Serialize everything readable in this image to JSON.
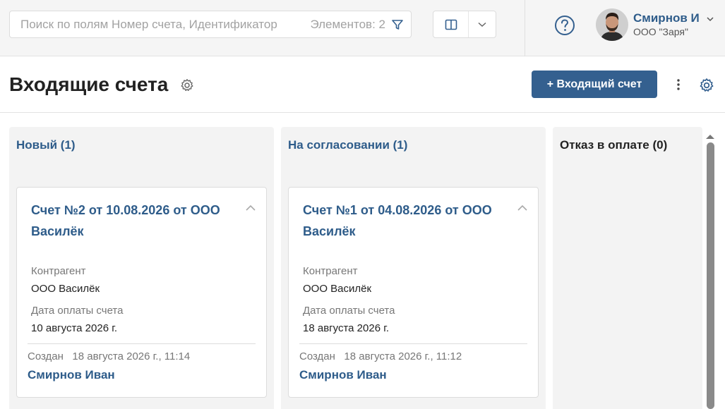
{
  "search": {
    "placeholder": "Поиск по полям Номер счета, Идентификатор",
    "count": "Элементов: 2"
  },
  "user": {
    "name": "Смирнов И",
    "org": "ООО \"Заря\""
  },
  "header": {
    "title": "Входящие счета",
    "add_button": "+ Входящий счет"
  },
  "columns": [
    {
      "title": "Новый (1)",
      "cards": [
        {
          "title": "Счет №2 от 10.08.2026 от ООО Василёк",
          "counterparty_label": "Контрагент",
          "counterparty": "ООО Василёк",
          "pay_date_label": "Дата оплаты счета",
          "pay_date": "10 августа 2026 г.",
          "created": "Создан   18 августа 2026 г., 11:14",
          "author": "Смирнов Иван"
        }
      ]
    },
    {
      "title": "На согласовании (1)",
      "cards": [
        {
          "title": "Счет №1 от 04.08.2026 от ООО Василёк",
          "counterparty_label": "Контрагент",
          "counterparty": "ООО Василёк",
          "pay_date_label": "Дата оплаты счета",
          "pay_date": "18 августа 2026 г.",
          "created": "Создан   18 августа 2026 г., 11:12",
          "author": "Смирнов Иван"
        }
      ]
    },
    {
      "title": "Отказ в оплате (0)",
      "cards": []
    }
  ],
  "icons": {
    "filter": "filter-icon",
    "view": "column-view-icon",
    "help": "help-circle-icon",
    "settings": "gear-icon",
    "more": "more-vertical-icon",
    "collapse": "chevron-up-icon"
  },
  "colors": {
    "accent": "#2e5c8a",
    "button": "#34608f"
  }
}
